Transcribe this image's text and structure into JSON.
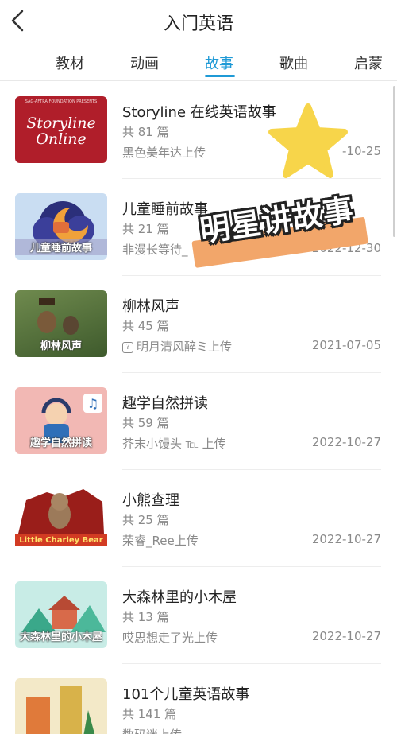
{
  "header": {
    "title": "入门英语"
  },
  "tabs": [
    {
      "label": "教材"
    },
    {
      "label": "动画"
    },
    {
      "label": "故事"
    },
    {
      "label": "歌曲"
    },
    {
      "label": "启蒙"
    }
  ],
  "items": [
    {
      "name": "Storyline 在线英语故事",
      "count": "共 81 篇",
      "uploader": "黑色美年达上传",
      "date": "-10-25",
      "thumb_text": "Storyline Online",
      "thumb_top": "SAG-AFTRA FOUNDATION PRESENTS"
    },
    {
      "name": "儿童睡前故事",
      "count": "共 21 篇",
      "uploader": "非漫长等待_",
      "date": "2022-12-30",
      "thumb_text": "儿童睡前故事"
    },
    {
      "name": "柳林风声",
      "count": "共 45 篇",
      "uploader": "明月清风醉ミ上传",
      "date": "2021-07-05",
      "thumb_text": "柳林风声"
    },
    {
      "name": "趣学自然拼读",
      "count": "共 59 篇",
      "uploader": "芥末小馒头 ℡ 上传",
      "date": "2022-10-27",
      "thumb_text": "趣学自然拼读"
    },
    {
      "name": "小熊查理",
      "count": "共 25 篇",
      "uploader": "荣睿_Ree上传",
      "date": "2022-10-27",
      "thumb_text": "Little Charley Bear"
    },
    {
      "name": "大森林里的小木屋",
      "count": "共 13 篇",
      "uploader": "哎思想走了光上传",
      "date": "2022-10-27",
      "thumb_text": "大森林里的小木屋"
    },
    {
      "name": "101个儿童英语故事",
      "count": "共 141 篇",
      "uploader": "数码迷上传",
      "date": ""
    }
  ],
  "overlay": {
    "banner_text": "明星讲故事"
  },
  "colors": {
    "accent": "#1f9ad6",
    "star": "#f7d54a",
    "banner": "#f2a66a"
  }
}
